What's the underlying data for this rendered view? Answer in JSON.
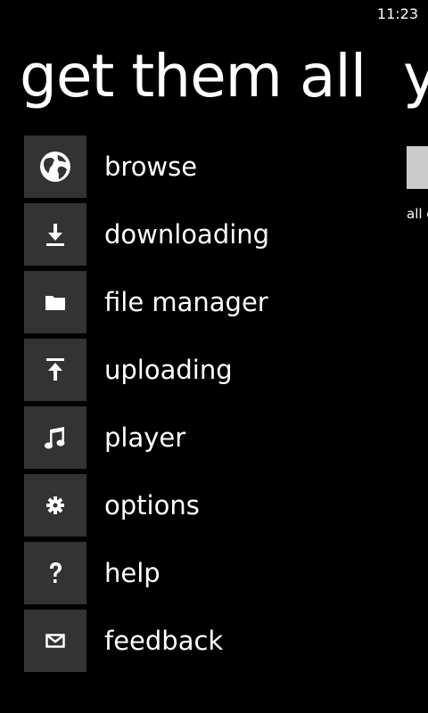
{
  "status_bar": {
    "time": "11:23"
  },
  "panorama": {
    "title": "get them all",
    "next_title_peek": "y",
    "next_section_caption_peek": "all c"
  },
  "menu": {
    "items": [
      {
        "label": "browse",
        "icon": "globe-icon"
      },
      {
        "label": "downloading",
        "icon": "download-icon"
      },
      {
        "label": "file manager",
        "icon": "folder-icon"
      },
      {
        "label": "uploading",
        "icon": "upload-icon"
      },
      {
        "label": "player",
        "icon": "music-note-icon"
      },
      {
        "label": "options",
        "icon": "gear-icon"
      },
      {
        "label": "help",
        "icon": "question-mark-icon"
      },
      {
        "label": "feedback",
        "icon": "envelope-icon"
      }
    ]
  },
  "colors": {
    "background": "#000000",
    "text": "#ffffff",
    "tile": "#333333",
    "peek_tile": "#cccccc"
  }
}
